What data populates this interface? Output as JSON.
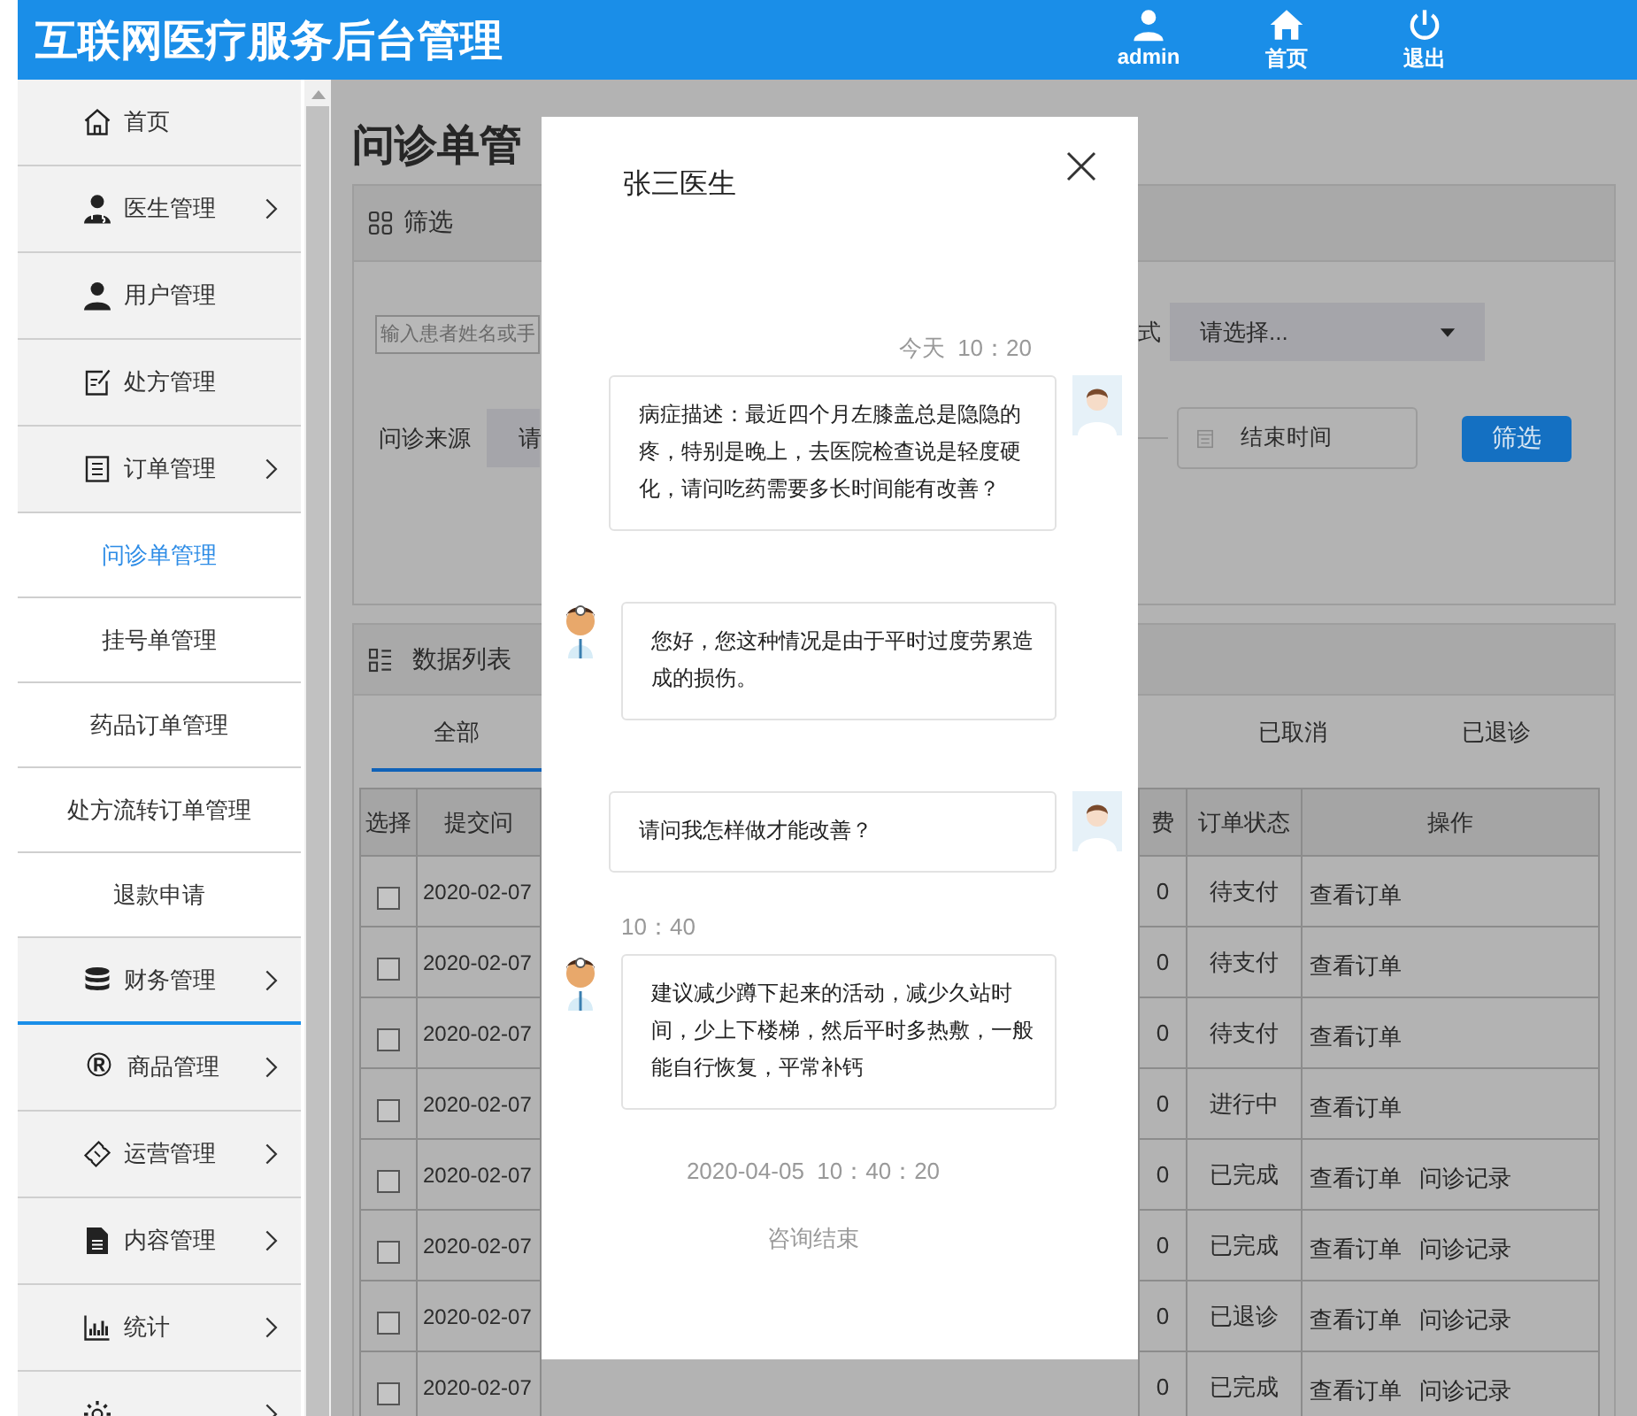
{
  "header": {
    "title": "互联网医疗服务后台管理",
    "nav": [
      {
        "label": "admin"
      },
      {
        "label": "首页"
      },
      {
        "label": "退出"
      }
    ]
  },
  "sidebar": {
    "items": [
      {
        "kind": "group",
        "label": "首页",
        "chevron": false,
        "active": false
      },
      {
        "kind": "group",
        "label": "医生管理",
        "chevron": true,
        "active": false
      },
      {
        "kind": "group",
        "label": "用户管理",
        "chevron": false,
        "active": false
      },
      {
        "kind": "group",
        "label": "处方管理",
        "chevron": false,
        "active": false
      },
      {
        "kind": "group",
        "label": "订单管理",
        "chevron": true,
        "active": false
      },
      {
        "kind": "sub",
        "label": "问诊单管理",
        "selected": true
      },
      {
        "kind": "sub",
        "label": "挂号单管理",
        "selected": false
      },
      {
        "kind": "sub",
        "label": "药品订单管理",
        "selected": false
      },
      {
        "kind": "sub",
        "label": "处方流转订单管理",
        "selected": false
      },
      {
        "kind": "sub",
        "label": "退款申请",
        "selected": false
      },
      {
        "kind": "group",
        "label": "财务管理",
        "chevron": true,
        "active": true
      },
      {
        "kind": "group",
        "icon_text": "®",
        "label": "商品管理",
        "chevron": true,
        "active": false
      },
      {
        "kind": "group",
        "label": "运营管理",
        "chevron": true,
        "active": false
      },
      {
        "kind": "group",
        "label": "内容管理",
        "chevron": true,
        "active": false
      },
      {
        "kind": "group",
        "label": "统计",
        "chevron": true,
        "active": false
      },
      {
        "kind": "group",
        "chevron": true,
        "active": false
      }
    ]
  },
  "page": {
    "title": "问诊单管",
    "filter": {
      "title": "筛选",
      "search": {
        "placeholder": "输入患者姓名或手"
      },
      "method_label": "式",
      "method_select": {
        "value": "请选择..."
      },
      "source_label": "问诊来源",
      "source_select": {
        "value": "请"
      },
      "end_date": {
        "placeholder": "结束时间"
      },
      "submit": "筛选"
    },
    "list": {
      "title": "数据列表",
      "tabs": [
        {
          "label": "全部",
          "selected": true
        },
        {
          "label": "已取消",
          "selected": false
        },
        {
          "label": "已退诊",
          "selected": false
        }
      ]
    },
    "table": {
      "columns": [
        "选择",
        "提交问",
        "费",
        "订单状态",
        "操作"
      ],
      "rows": [
        {
          "checked": false,
          "submitted": "2020-02-07",
          "fee": "0",
          "status": "待支付",
          "actions": [
            "查看订单"
          ]
        },
        {
          "checked": false,
          "submitted": "2020-02-07",
          "fee": "0",
          "status": "待支付",
          "actions": [
            "查看订单"
          ]
        },
        {
          "checked": false,
          "submitted": "2020-02-07",
          "fee": "0",
          "status": "待支付",
          "actions": [
            "查看订单"
          ]
        },
        {
          "checked": false,
          "submitted": "2020-02-07",
          "fee": "0",
          "status": "进行中",
          "actions": [
            "查看订单"
          ]
        },
        {
          "checked": false,
          "submitted": "2020-02-07",
          "fee": "0",
          "status": "已完成",
          "actions": [
            "查看订单",
            "问诊记录"
          ]
        },
        {
          "checked": false,
          "submitted": "2020-02-07",
          "fee": "0",
          "status": "已完成",
          "actions": [
            "查看订单",
            "问诊记录"
          ]
        },
        {
          "checked": false,
          "submitted": "2020-02-07",
          "fee": "0",
          "status": "已退诊",
          "actions": [
            "查看订单",
            "问诊记录"
          ]
        },
        {
          "checked": false,
          "submitted": "2020-02-07",
          "fee": "0",
          "status": "已完成",
          "actions": [
            "查看订单",
            "问诊记录"
          ]
        }
      ]
    }
  },
  "chat": {
    "title": "张三医生",
    "messages": [
      {
        "kind": "patient",
        "time": "今天  10：20",
        "text": "病症描述：最近四个月左膝盖总是隐隐的疼，特别是晚上，去医院检查说是轻度硬化，请问吃药需要多长时间能有改善？"
      },
      {
        "kind": "doctor",
        "text": "您好，您这种情况是由于平时过度劳累造成的损伤。"
      },
      {
        "kind": "patient",
        "text": "请问我怎样做才能改善？"
      },
      {
        "kind": "doctor",
        "time": "10：40",
        "text": "建议减少蹲下起来的活动，减少久站时间，少上下楼梯，然后平时多热敷，一般能自行恢复，平常补钙"
      }
    ],
    "ended_at": "2020-04-05  10：40：20",
    "status": "咨询结束"
  }
}
